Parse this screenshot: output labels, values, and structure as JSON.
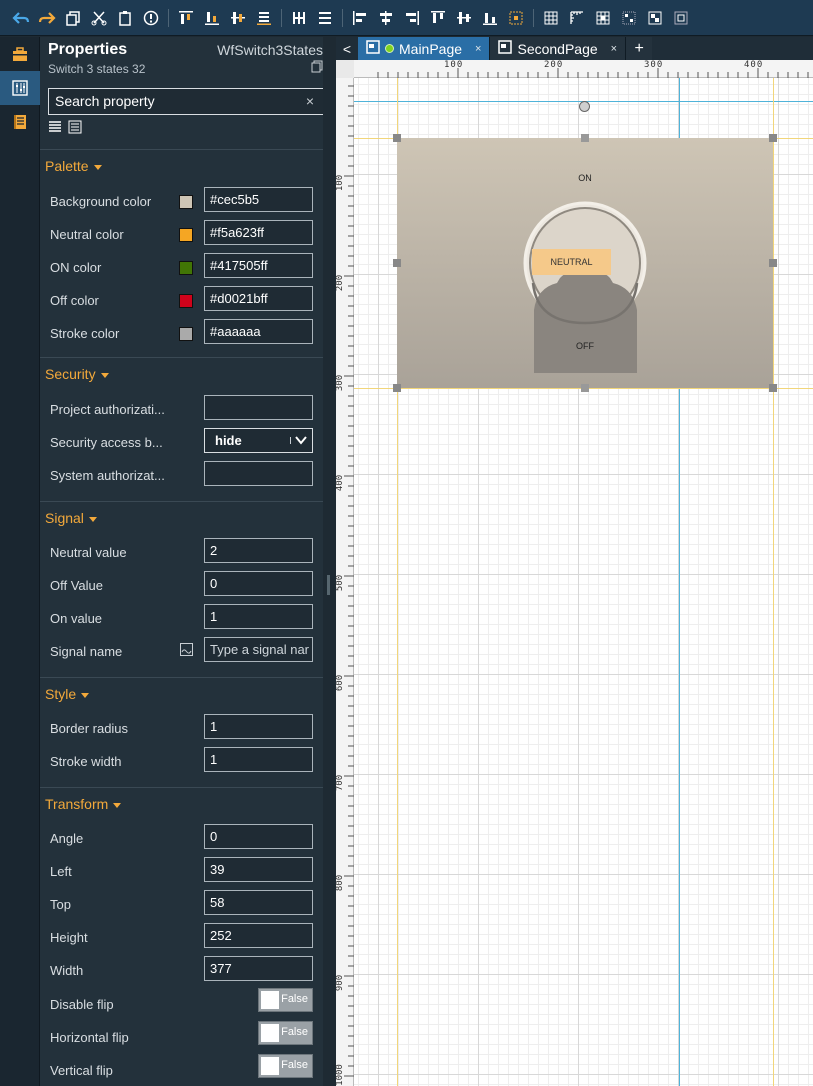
{
  "toolbar": {
    "icons": [
      "undo-icon",
      "redo-icon",
      "copy-icon",
      "cut-icon",
      "paste-icon",
      "info-icon",
      "align-top-icon",
      "align-bottom-icon",
      "align-middle-icon",
      "align-baseline-icon",
      "distribute-h-icon",
      "distribute-v-icon",
      "align-left-icon",
      "align-center-icon",
      "align-right-icon",
      "align-top-edge-icon",
      "align-center-v-icon",
      "align-bottom-edge-icon",
      "same-size-icon",
      "grid-icon",
      "ruler-icon",
      "snap-icon",
      "grid-dots-icon",
      "group-icon",
      "ungroup-icon"
    ]
  },
  "properties": {
    "title": "Properties",
    "component_type": "WfSwitch3States",
    "subtitle": "Switch 3 states 32",
    "search_placeholder": "Search property",
    "search_clear": "×"
  },
  "sections": {
    "palette": {
      "title": "Palette",
      "rows": [
        {
          "label": "Background color",
          "value": "#cec5b5",
          "swatch": "#cec5b5"
        },
        {
          "label": "Neutral color",
          "value": "#f5a623ff",
          "swatch": "#f5a623"
        },
        {
          "label": "ON color",
          "value": "#417505ff",
          "swatch": "#417505"
        },
        {
          "label": "Off color",
          "value": "#d0021bff",
          "swatch": "#d0021b"
        },
        {
          "label": "Stroke color",
          "value": "#aaaaaa",
          "swatch": "#aaaaaa"
        }
      ]
    },
    "security": {
      "title": "Security",
      "rows": [
        {
          "label": "Project authorizati...",
          "value": ""
        },
        {
          "label": "Security access b...",
          "value": "hide"
        },
        {
          "label": "System authorizat...",
          "value": ""
        }
      ]
    },
    "signal": {
      "title": "Signal",
      "rows": [
        {
          "label": "Neutral value",
          "value": "2"
        },
        {
          "label": "Off Value",
          "value": "0"
        },
        {
          "label": "On value",
          "value": "1"
        },
        {
          "label": "Signal name",
          "value": "Type a signal nar"
        }
      ]
    },
    "style": {
      "title": "Style",
      "rows": [
        {
          "label": "Border radius",
          "value": "1"
        },
        {
          "label": "Stroke width",
          "value": "1"
        }
      ]
    },
    "transform": {
      "title": "Transform",
      "rows": [
        {
          "label": "Angle",
          "value": "0"
        },
        {
          "label": "Left",
          "value": "39"
        },
        {
          "label": "Top",
          "value": "58"
        },
        {
          "label": "Height",
          "value": "252"
        },
        {
          "label": "Width",
          "value": "377"
        },
        {
          "label": "Disable flip",
          "value": "False"
        },
        {
          "label": "Horizontal flip",
          "value": "False"
        },
        {
          "label": "Vertical flip",
          "value": "False"
        }
      ]
    }
  },
  "tabs": [
    {
      "label": "MainPage",
      "active": true
    },
    {
      "label": "SecondPage",
      "active": false
    }
  ],
  "tab_nav": "<",
  "tab_add": "+",
  "tab_close": "×",
  "rulers": {
    "h": [
      "100",
      "200",
      "300",
      "400"
    ],
    "v": [
      "100",
      "200",
      "300",
      "400",
      "500",
      "600",
      "700",
      "800",
      "900",
      "1000"
    ]
  },
  "switch_widget": {
    "on_label": "ON",
    "off_label": "OFF",
    "neutral_label": "NEUTRAL",
    "background": "#cec5b5"
  },
  "colors": {
    "accent": "#f3a93b",
    "tab_active": "#2a6ea6",
    "panel_bg": "#23313b"
  }
}
